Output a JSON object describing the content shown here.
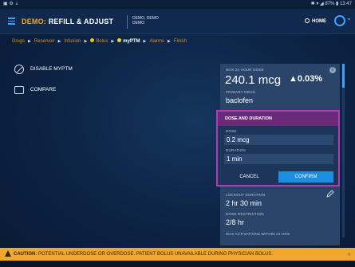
{
  "status_bar": {
    "left": "▣ ⚙ ⇣",
    "right": "✱ ▾ ◢ 87% ▮ 13:47"
  },
  "header": {
    "title_prefix": "DEMO:",
    "title_main": "REFILL & ADJUST",
    "demo_line1": "DEMO, DEMO",
    "demo_line2": "DEMO",
    "home_label": "HOME",
    "settings_caret": "▾"
  },
  "breadcrumb": [
    {
      "label": "Drugs"
    },
    {
      "label": "Reservoir"
    },
    {
      "label": "Infusion"
    },
    {
      "label": "Bolus"
    },
    {
      "label": "myPTM",
      "active": true
    },
    {
      "label": "Alarms"
    },
    {
      "label": "Finish"
    }
  ],
  "breadcrumb_sep": "▶",
  "left_actions": {
    "disable_label": "DISABLE MYPTM",
    "compare_label": "COMPARE"
  },
  "right_panel": {
    "max24_label": "MAX 24 HOUR DOSE",
    "max24_value": "240.1 mcg",
    "delta_value": "▲0.03%",
    "primary_drug_label": "PRIMARY DRUG",
    "primary_drug_value": "baclofen",
    "info_icon": "i",
    "lockout_label": "LOCKOUT DURATION",
    "lockout_value": "2 hr 30 min",
    "dose_restriction_label": "DOSE RESTRICTION",
    "dose_restriction_value": "2/8 hr",
    "max_activations_label": "MAX ACTIVATIONS WITHIN 24 HRS"
  },
  "dose_card": {
    "header": "DOSE AND DURATION",
    "dose_label": "DOSE",
    "dose_value": "0.2 mcg",
    "duration_label": "DURATION",
    "duration_value": "1 min",
    "cancel_label": "CANCEL",
    "confirm_label": "CONFIRM"
  },
  "caution": {
    "keyword": "CAUTION:",
    "message": "POTENTIAL UNDERDOSE OR OVERDOSE. PATIENT BOLUS UNAVAILABLE DURING PHYSICIAN BOLUS.",
    "chevron": "‹"
  },
  "colors": {
    "accent_blue": "#1c8fe0",
    "caution_orange": "#f1a72a",
    "highlight_magenta": "#b53bb6",
    "breadcrumb_orange": "#e6872a"
  }
}
